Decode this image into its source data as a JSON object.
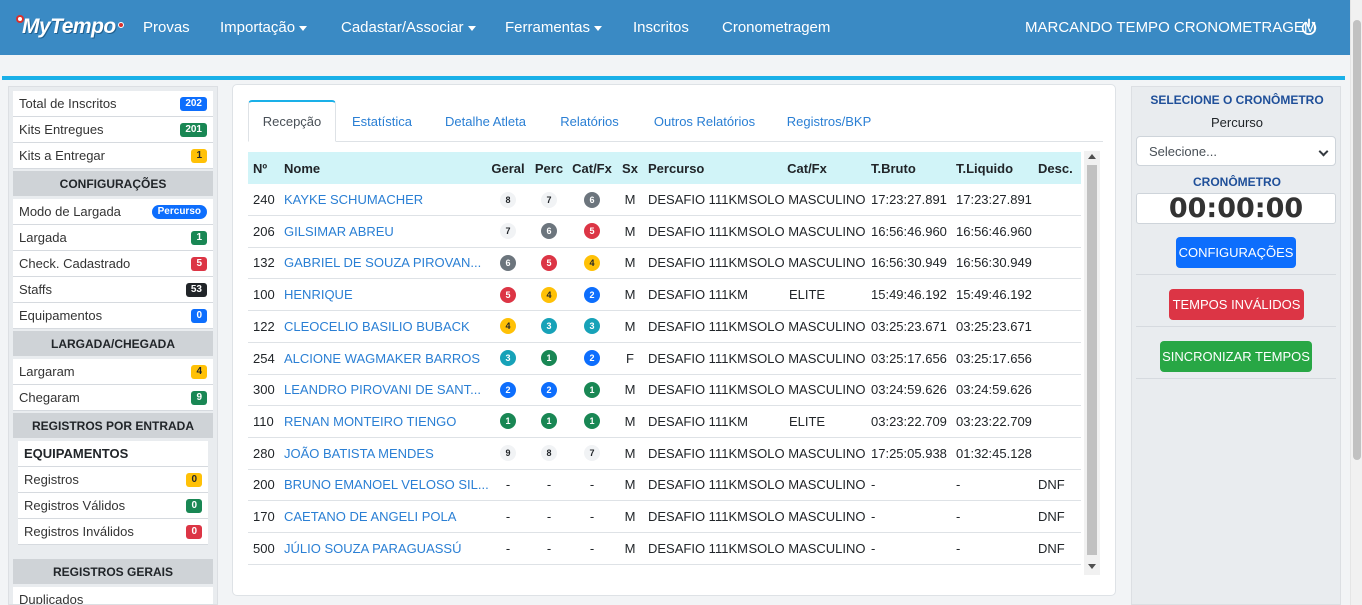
{
  "app": {
    "brand": "MyTempo",
    "nav": [
      {
        "label": "Provas",
        "dropdown": false
      },
      {
        "label": "Importação",
        "dropdown": true
      },
      {
        "label": "Cadastar/Associar",
        "dropdown": true
      },
      {
        "label": "Ferramentas",
        "dropdown": true
      },
      {
        "label": "Inscritos",
        "dropdown": false
      },
      {
        "label": "Cronometragem",
        "dropdown": false
      }
    ],
    "organization": "MARCANDO TEMPO CRONOMETRAGEM",
    "logout_icon": "power-icon"
  },
  "sidebar": {
    "summary": [
      {
        "label": "Total de Inscritos",
        "badge": "202",
        "color": "#0d6efd"
      },
      {
        "label": "Kits Entregues",
        "badge": "201",
        "color": "#198754"
      },
      {
        "label": "Kits a Entregar",
        "badge": "1",
        "color": "#ffc107"
      }
    ],
    "config_title": "CONFIGURAÇÕES",
    "config": [
      {
        "label": "Modo de Largada",
        "badge": "Percurso",
        "color": "#0d6efd"
      },
      {
        "label": "Largada",
        "badge": "1",
        "color": "#198754"
      },
      {
        "label": "Check. Cadastrado",
        "badge": "5",
        "color": "#dc3545"
      },
      {
        "label": "Staffs",
        "badge": "53",
        "color": "#212529"
      },
      {
        "label": "Equipamentos",
        "badge": "0",
        "color": "#0d6efd"
      }
    ],
    "largada_title": "LARGADA/CHEGADA",
    "largada": [
      {
        "label": "Largaram",
        "badge": "4",
        "color": "#ffc107"
      },
      {
        "label": "Chegaram",
        "badge": "9",
        "color": "#198754"
      }
    ],
    "registros_entrada_title": "REGISTROS POR ENTRADA",
    "equipamentos_label": "EQUIPAMENTOS",
    "registros_entrada": [
      {
        "label": "Registros",
        "badge": "0",
        "color": "#ffc107"
      },
      {
        "label": "Registros Válidos",
        "badge": "0",
        "color": "#198754"
      },
      {
        "label": "Registros Inválidos",
        "badge": "0",
        "color": "#dc3545"
      }
    ],
    "registros_gerais_title": "REGISTROS GERAIS",
    "registros_gerais_first": "Duplicados"
  },
  "tabs": [
    {
      "label": "Recepção",
      "active": true
    },
    {
      "label": "Estatística",
      "active": false
    },
    {
      "label": "Detalhe Atleta",
      "active": false
    },
    {
      "label": "Relatórios",
      "active": false
    },
    {
      "label": "Outros Relatórios",
      "active": false
    },
    {
      "label": "Registros/BKP",
      "active": false
    }
  ],
  "table": {
    "columns": [
      "Nº",
      "Nome",
      "Geral",
      "Perc",
      "Cat/Fx",
      "Sx",
      "Percurso",
      "Cat/Fx",
      "T.Bruto",
      "T.Liquido",
      "Desc."
    ],
    "rows": [
      {
        "num": "240",
        "nome": "KAYKE SCHUMACHER",
        "geral": "8",
        "perc": "7",
        "catfx_pos": "6",
        "sx": "M",
        "percurso": "DESAFIO 111KM",
        "categoria": "SOLO MASCULINO",
        "bruto": "17:23:27.891",
        "liquido": "17:23:27.891",
        "desc": ""
      },
      {
        "num": "206",
        "nome": "GILSIMAR ABREU",
        "geral": "7",
        "perc": "6",
        "catfx_pos": "5",
        "sx": "M",
        "percurso": "DESAFIO 111KM",
        "categoria": "SOLO MASCULINO",
        "bruto": "16:56:46.960",
        "liquido": "16:56:46.960",
        "desc": ""
      },
      {
        "num": "132",
        "nome": "GABRIEL DE SOUZA PIROVAN...",
        "geral": "6",
        "perc": "5",
        "catfx_pos": "4",
        "sx": "M",
        "percurso": "DESAFIO 111KM",
        "categoria": "SOLO MASCULINO",
        "bruto": "16:56:30.949",
        "liquido": "16:56:30.949",
        "desc": ""
      },
      {
        "num": "100",
        "nome": "HENRIQUE",
        "geral": "5",
        "perc": "4",
        "catfx_pos": "2",
        "sx": "M",
        "percurso": "DESAFIO 111KM",
        "categoria": "ELITE",
        "bruto": "15:49:46.192",
        "liquido": "15:49:46.192",
        "desc": ""
      },
      {
        "num": "122",
        "nome": "CLEOCELIO BASILIO BUBACK",
        "geral": "4",
        "perc": "3",
        "catfx_pos": "3",
        "sx": "M",
        "percurso": "DESAFIO 111KM",
        "categoria": "SOLO MASCULINO",
        "bruto": "03:25:23.671",
        "liquido": "03:25:23.671",
        "desc": ""
      },
      {
        "num": "254",
        "nome": "ALCIONE WAGMAKER BARROS",
        "geral": "3",
        "perc": "1",
        "catfx_pos": "2",
        "sx": "F",
        "percurso": "DESAFIO 111KM",
        "categoria": "SOLO MASCULINO",
        "bruto": "03:25:17.656",
        "liquido": "03:25:17.656",
        "desc": ""
      },
      {
        "num": "300",
        "nome": "LEANDRO PIROVANI DE SANT...",
        "geral": "2",
        "perc": "2",
        "catfx_pos": "1",
        "sx": "M",
        "percurso": "DESAFIO 111KM",
        "categoria": "SOLO MASCULINO",
        "bruto": "03:24:59.626",
        "liquido": "03:24:59.626",
        "desc": ""
      },
      {
        "num": "110",
        "nome": "RENAN MONTEIRO TIENGO",
        "geral": "1",
        "perc": "1",
        "catfx_pos": "1",
        "sx": "M",
        "percurso": "DESAFIO 111KM",
        "categoria": "ELITE",
        "bruto": "03:23:22.709",
        "liquido": "03:23:22.709",
        "desc": ""
      },
      {
        "num": "280",
        "nome": "JOÃO BATISTA MENDES",
        "geral": "9",
        "perc": "8",
        "catfx_pos": "7",
        "sx": "M",
        "percurso": "DESAFIO 111KM",
        "categoria": "SOLO MASCULINO",
        "bruto": "17:25:05.938",
        "liquido": "01:32:45.128",
        "desc": ""
      },
      {
        "num": "200",
        "nome": "BRUNO EMANOEL VELOSO SIL...",
        "geral": "-",
        "perc": "-",
        "catfx_pos": "-",
        "sx": "M",
        "percurso": "DESAFIO 111KM",
        "categoria": "SOLO MASCULINO",
        "bruto": "-",
        "liquido": "-",
        "desc": "DNF"
      },
      {
        "num": "170",
        "nome": "CAETANO DE ANGELI POLA",
        "geral": "-",
        "perc": "-",
        "catfx_pos": "-",
        "sx": "M",
        "percurso": "DESAFIO 111KM",
        "categoria": "SOLO MASCULINO",
        "bruto": "-",
        "liquido": "-",
        "desc": "DNF"
      },
      {
        "num": "500",
        "nome": "JÚLIO SOUZA PARAGUASSÚ",
        "geral": "-",
        "perc": "-",
        "catfx_pos": "-",
        "sx": "M",
        "percurso": "DESAFIO 111KM",
        "categoria": "SOLO MASCULINO",
        "bruto": "-",
        "liquido": "-",
        "desc": "DNF"
      }
    ]
  },
  "right_panel": {
    "title": "SELECIONE O CRONÔMETRO",
    "subtitle": "Percurso",
    "select_value": "Selecione...",
    "crono_title": "CRONÔMETRO",
    "clock": "00:00:00",
    "btn_config": "CONFIGURAÇÕES",
    "btn_invalid": "TEMPOS INVÁLIDOS",
    "btn_sync": "SINCRONIZAR TEMPOS"
  }
}
